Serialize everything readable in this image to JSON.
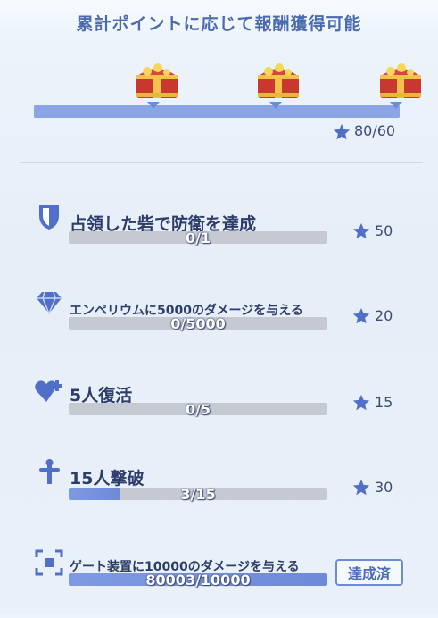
{
  "header": {
    "title": "累計ポイントに応じて報酬獲得可能"
  },
  "milestones": {
    "progress_fraction": 1.0,
    "total_text": "80/60",
    "chests": [
      {
        "icon": "treasure-chest-icon"
      },
      {
        "icon": "treasure-chest-icon"
      },
      {
        "icon": "treasure-chest-icon"
      }
    ]
  },
  "tasks": [
    {
      "icon": "shield-icon",
      "title": "占領した砦で防衛を達成",
      "progress_text": "0/1",
      "progress_fraction": 0.0,
      "reward": "50"
    },
    {
      "icon": "diamond-icon",
      "title": "エンペリウムに5000のダメージを与える",
      "progress_text": "0/5000",
      "progress_fraction": 0.0,
      "reward": "20"
    },
    {
      "icon": "heart-plus-icon",
      "title": "5人復活",
      "progress_text": "0/5",
      "progress_fraction": 0.0,
      "reward": "15"
    },
    {
      "icon": "sword-icon",
      "title": "15人撃破",
      "progress_text": "3/15",
      "progress_fraction": 0.2,
      "reward": "30"
    },
    {
      "icon": "target-frame-icon",
      "title": "ゲート装置に10000のダメージを与える",
      "progress_text": "80003/10000",
      "progress_fraction": 1.0,
      "status_button": "達成済"
    }
  ],
  "colors": {
    "accent": "#6e8bd3",
    "bar_empty": "#c4c9d2",
    "bar_fill": "#7f9ae0"
  }
}
